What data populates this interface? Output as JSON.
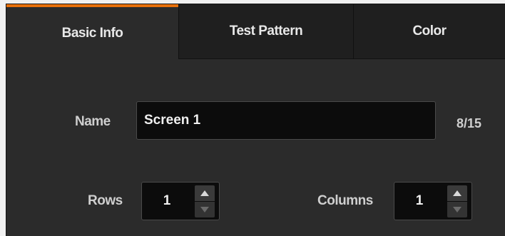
{
  "tabs": [
    {
      "label": "Basic Info",
      "active": true
    },
    {
      "label": "Test Pattern",
      "active": false
    },
    {
      "label": "Color",
      "active": false
    }
  ],
  "accent_color": "#e8700a",
  "form": {
    "name_label": "Name",
    "name_value": "Screen 1",
    "name_counter": "8/15",
    "rows_label": "Rows",
    "rows_value": "1",
    "columns_label": "Columns",
    "columns_value": "1"
  },
  "icons": {
    "increment": "caret-up-icon",
    "decrement": "caret-down-icon"
  }
}
